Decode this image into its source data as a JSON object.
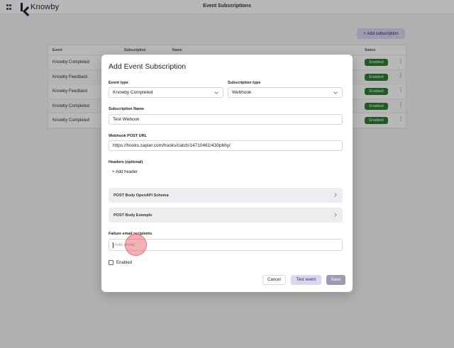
{
  "app": {
    "logo_text": "Knowby",
    "title": "Event Subscriptions"
  },
  "toolbar": {
    "add_subscription_label": "+ Add subscription"
  },
  "table": {
    "headers": [
      "Event",
      "Subscription",
      "Name",
      "Status"
    ],
    "rows": [
      {
        "event": "Knowby Completed",
        "status": "Enabled"
      },
      {
        "event": "Knowby Feedback",
        "status": "Enabled"
      },
      {
        "event": "Knowby Feedback",
        "status": "Enabled"
      },
      {
        "event": "Knowby Completed",
        "status": "Enabled"
      },
      {
        "event": "Knowby Completed",
        "status": "Enabled"
      }
    ],
    "kebab_glyph": "⋮"
  },
  "modal": {
    "title": "Add Event Subscription",
    "event_type": {
      "label": "Event type",
      "value": "Knowby Completed"
    },
    "subscription_type": {
      "label": "Subscription type",
      "value": "Webhook"
    },
    "subscription_name": {
      "label": "Subscription Name",
      "value": "Test Webook"
    },
    "webhook_url": {
      "label": "Webhook POST URL",
      "value": "https://hooks.zapier.com/hooks/catch/14710461/430pbhy/"
    },
    "headers": {
      "label": "Headers (optional)",
      "add_label": "+ Add header"
    },
    "accordions": [
      {
        "label": "POST Body OpenAPI Schema"
      },
      {
        "label": "POST Body Example"
      }
    ],
    "failure_email": {
      "label": "Failure email recipients",
      "placeholder": "Add email"
    },
    "enabled_label": "Enabled",
    "buttons": {
      "cancel": "Cancel",
      "test": "Test event",
      "save": "Save"
    }
  },
  "colors": {
    "accent": "#d9d8ef",
    "enabled_badge": "#2e7d32",
    "save_disabled": "#9b9bb5"
  }
}
